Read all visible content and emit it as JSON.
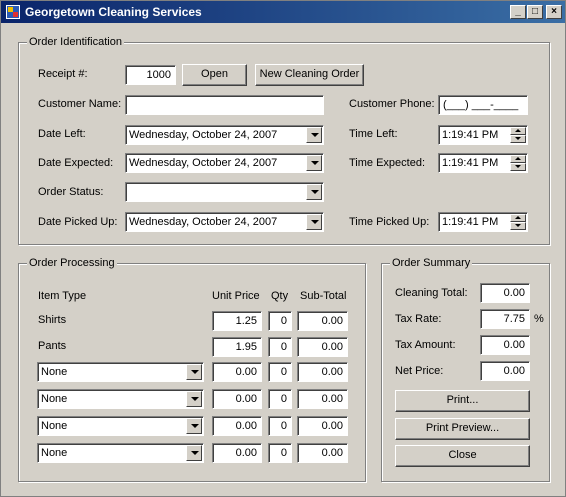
{
  "window": {
    "title": "Georgetown Cleaning Services",
    "min": "_",
    "max": "□",
    "close": "×"
  },
  "order_identification": {
    "group_label": "Order Identification",
    "receipt_label": "Receipt #:",
    "receipt_value": "1000",
    "open_button": "Open",
    "new_order_button": "New Cleaning Order",
    "customer_name_label": "Customer Name:",
    "customer_name_value": "",
    "customer_phone_label": "Customer Phone:",
    "customer_phone_value": "(___) ___-____",
    "date_left_label": "Date Left:",
    "date_left_value": "Wednesday,   October   24, 2007",
    "time_left_label": "Time Left:",
    "time_left_value": "1:19:41 PM",
    "date_expected_label": "Date Expected:",
    "date_expected_value": "Wednesday,   October   24, 2007",
    "time_expected_label": "Time Expected:",
    "time_expected_value": "1:19:41 PM",
    "order_status_label": "Order Status:",
    "order_status_value": "",
    "date_picked_label": "Date Picked Up:",
    "date_picked_value": "Wednesday,   October   24, 2007",
    "time_picked_label": "Time Picked Up:",
    "time_picked_value": "1:19:41 PM"
  },
  "order_processing": {
    "group_label": "Order Processing",
    "headers": {
      "item_type": "Item Type",
      "unit_price": "Unit Price",
      "qty": "Qty",
      "sub_total": "Sub-Total"
    },
    "rows": [
      {
        "item": "Shirts",
        "unit_price": "1.25",
        "qty": "0",
        "sub_total": "0.00"
      },
      {
        "item": "Pants",
        "unit_price": "1.95",
        "qty": "0",
        "sub_total": "0.00"
      },
      {
        "item": "None",
        "unit_price": "0.00",
        "qty": "0",
        "sub_total": "0.00"
      },
      {
        "item": "None",
        "unit_price": "0.00",
        "qty": "0",
        "sub_total": "0.00"
      },
      {
        "item": "None",
        "unit_price": "0.00",
        "qty": "0",
        "sub_total": "0.00"
      },
      {
        "item": "None",
        "unit_price": "0.00",
        "qty": "0",
        "sub_total": "0.00"
      }
    ]
  },
  "order_summary": {
    "group_label": "Order Summary",
    "cleaning_total_label": "Cleaning Total:",
    "cleaning_total_value": "0.00",
    "tax_rate_label": "Tax Rate:",
    "tax_rate_value": "7.75",
    "percent": "%",
    "tax_amount_label": "Tax Amount:",
    "tax_amount_value": "0.00",
    "net_price_label": "Net Price:",
    "net_price_value": "0.00",
    "print_button": "Print...",
    "print_preview_button": "Print Preview...",
    "close_button": "Close"
  }
}
